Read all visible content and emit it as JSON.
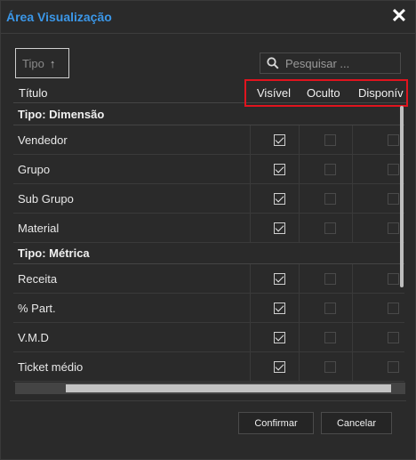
{
  "dialog": {
    "title": "Área Visualização",
    "close_glyph": "✕"
  },
  "toolbar": {
    "sort_label": "Tipo",
    "sort_arrow": "↑",
    "search_placeholder": "Pesquisar ..."
  },
  "columns": {
    "title": "Título",
    "visible": "Visível",
    "hidden": "Oculto",
    "available": "Disponív"
  },
  "groups": [
    {
      "label": "Tipo: Dimensão",
      "rows": [
        {
          "label": "Vendedor",
          "visible": true,
          "hidden": false,
          "available": false
        },
        {
          "label": "Grupo",
          "visible": true,
          "hidden": false,
          "available": false
        },
        {
          "label": "Sub Grupo",
          "visible": true,
          "hidden": false,
          "available": false
        },
        {
          "label": "Material",
          "visible": true,
          "hidden": false,
          "available": false
        }
      ]
    },
    {
      "label": "Tipo: Métrica",
      "rows": [
        {
          "label": "Receita",
          "visible": true,
          "hidden": false,
          "available": false
        },
        {
          "label": "% Part.",
          "visible": true,
          "hidden": false,
          "available": false
        },
        {
          "label": "V.M.D",
          "visible": true,
          "hidden": false,
          "available": false
        },
        {
          "label": "Ticket médio",
          "visible": true,
          "hidden": false,
          "available": false
        }
      ]
    }
  ],
  "footer": {
    "confirm_label": "Confirmar",
    "cancel_label": "Cancelar"
  },
  "colors": {
    "title": "#3b97e8",
    "highlight_border": "#e0141e",
    "background": "#2a2a2a"
  }
}
